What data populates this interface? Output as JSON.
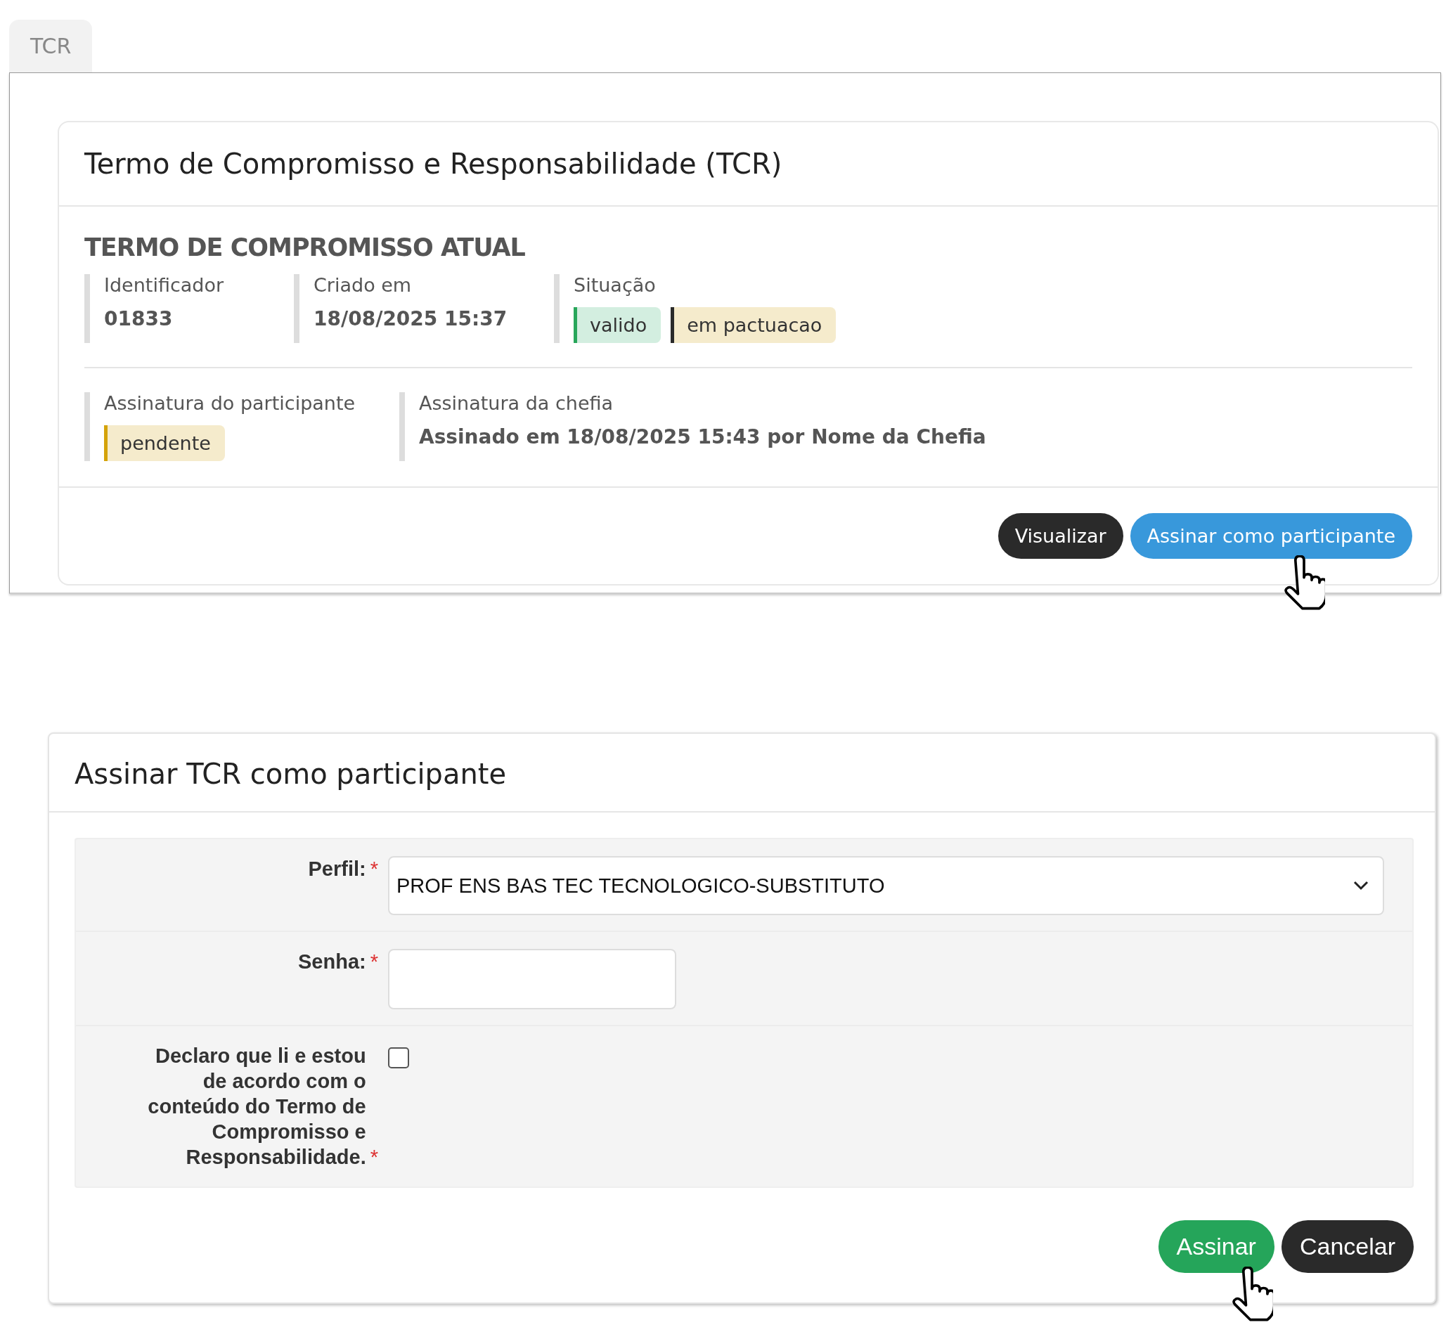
{
  "tabs": [
    {
      "label": "TCR",
      "selected": true
    }
  ],
  "tcr_card": {
    "title": "Termo de Compromisso e Responsabilidade (TCR)",
    "section_title": "TERMO DE COMPROMISSO ATUAL",
    "fields": [
      {
        "label": "Identificador",
        "value": "01833"
      },
      {
        "label": "Criado em",
        "value": "18/08/2025 15:37"
      },
      {
        "label": "Situação",
        "badges": [
          {
            "text": "valido",
            "kind": "success",
            "color": "#28a65a"
          },
          {
            "text": "em pactuacao",
            "kind": "warning",
            "color": "#2a2a2a"
          }
        ]
      }
    ],
    "signatures": [
      {
        "label": "Assinatura do participante",
        "badges": [
          {
            "text": "pendente",
            "kind": "warning",
            "color": "#d4a30a"
          }
        ]
      },
      {
        "label": "Assinatura da chefia",
        "value": "Assinado em 18/08/2025 15:43 por Nome da Chefia"
      }
    ],
    "buttons": [
      {
        "label": "Visualizar",
        "kind": "dark"
      },
      {
        "label": "Assinar como participante",
        "kind": "primary"
      }
    ]
  },
  "sign_dialog": {
    "title": "Assinar TCR como participante",
    "form": [
      {
        "kind": "select",
        "label": "Perfil:",
        "marker": "*",
        "value": "PROF ENS BAS TEC TECNOLOGICO-SUBSTITUTO"
      },
      {
        "kind": "password",
        "label": "Senha:",
        "marker": "*"
      },
      {
        "kind": "checkbox",
        "label": "Declaro que li e estou de acordo com o conteúdo do Termo de Compromisso e Responsabilidade.",
        "marker": "*",
        "checked": false
      }
    ],
    "buttons": [
      {
        "label": "Assinar",
        "kind": "success"
      },
      {
        "label": "Cancelar",
        "kind": "dark"
      }
    ]
  }
}
